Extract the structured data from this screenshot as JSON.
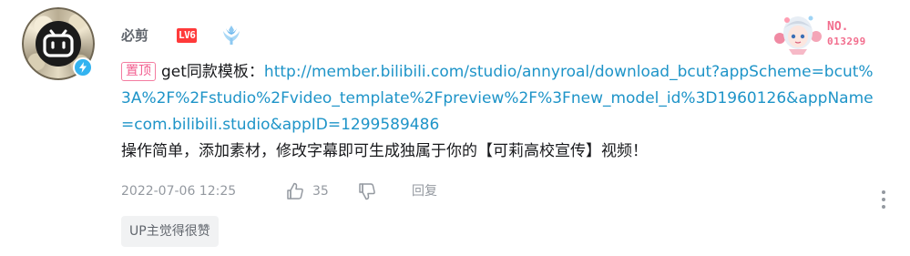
{
  "comment": {
    "user": {
      "name": "必剪",
      "level": "LV6"
    },
    "decoration": {
      "label": "NO.",
      "number": "013299"
    },
    "pin_label": "置顶",
    "text_prefix": "get同款模板：",
    "link": "http://member.bilibili.com/studio/annyroal/download_bcut?appScheme=bcut%3A%2F%2Fstudio%2Fvideo_template%2Fpreview%2F%3Fnew_model_id%3D1960126&appName=com.bilibili.studio&appID=1299589486",
    "text_second": "操作简单，添加素材，修改字幕即可生成独属于你的【可莉高校宣传】视频！",
    "time": "2022-07-06 12:25",
    "like_count": "35",
    "reply_label": "回复",
    "up_liked_label": "UP主觉得很赞"
  },
  "colors": {
    "link": "#1e94c8",
    "pin": "#f25d8e",
    "level_badge": "#ff3a3a",
    "meta_text": "#9499a0",
    "username": "#61666d",
    "official_badge": "#33b3f0"
  },
  "icons": {
    "like": "thumbs-up-icon",
    "dislike": "thumbs-down-icon",
    "more": "vertical-ellipsis-icon",
    "medal": "medal-icon",
    "official": "lightning-icon"
  }
}
